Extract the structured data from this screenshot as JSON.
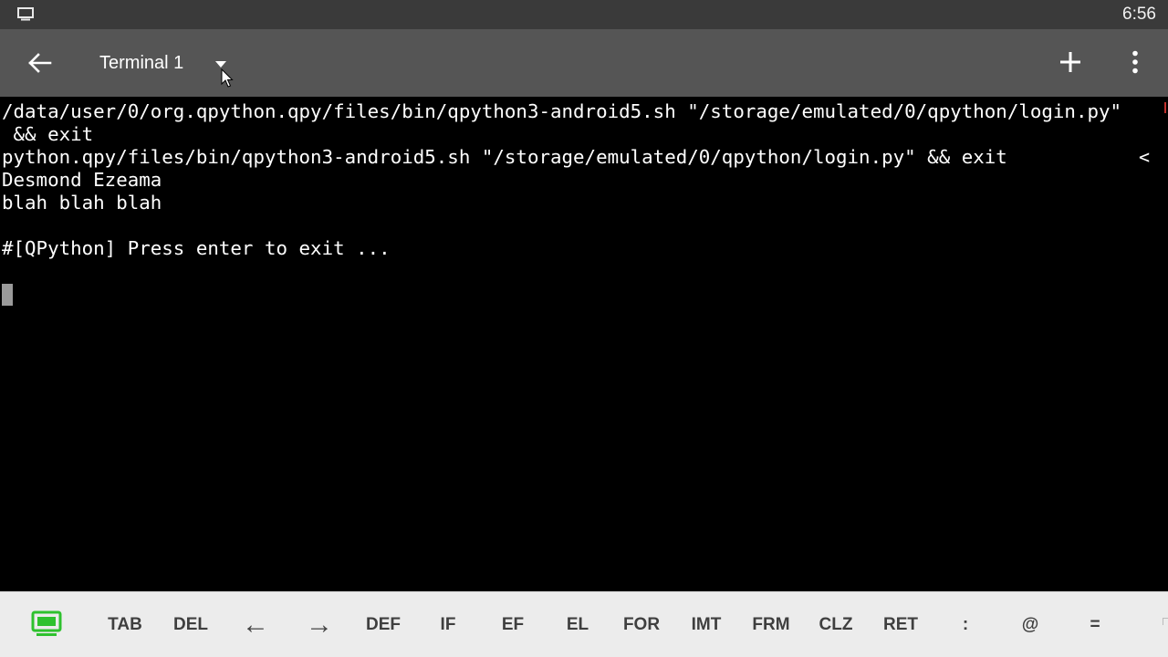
{
  "status_bar": {
    "time": "6:56",
    "screen_icon": "monitor-icon"
  },
  "toolbar": {
    "back_icon": "arrow-left-icon",
    "title": "Terminal 1",
    "dropdown_icon": "caret-down-icon",
    "add_icon": "plus-icon",
    "more_icon": "more-vertical-icon"
  },
  "terminal": {
    "lines": [
      "/data/user/0/org.qpython.qpy/files/bin/qpython3-android5.sh \"/storage/emulated/0/qpython/login.py\"",
      " && exit",
      "python.qpy/files/bin/qpython3-android5.sh \"/storage/emulated/0/qpython/login.py\" && exit",
      "Desmond Ezeama",
      "blah blah blah",
      "",
      "#[QPython] Press enter to exit ..."
    ],
    "overflow_marker": "<"
  },
  "keybar": {
    "toggle_icon": "keyboard-toggle-icon",
    "keys": [
      "TAB",
      "DEL",
      "←",
      "→",
      "DEF",
      "IF",
      "EF",
      "EL",
      "FOR",
      "IMT",
      "FRM",
      "CLZ",
      "RET",
      ":",
      "@",
      "="
    ]
  },
  "colors": {
    "status_bar_bg": "#3a3a3a",
    "toolbar_bg": "#555555",
    "terminal_bg": "#000000",
    "terminal_fg": "#ffffff",
    "keybar_bg": "#ececec",
    "accent_green": "#2ec12e"
  }
}
